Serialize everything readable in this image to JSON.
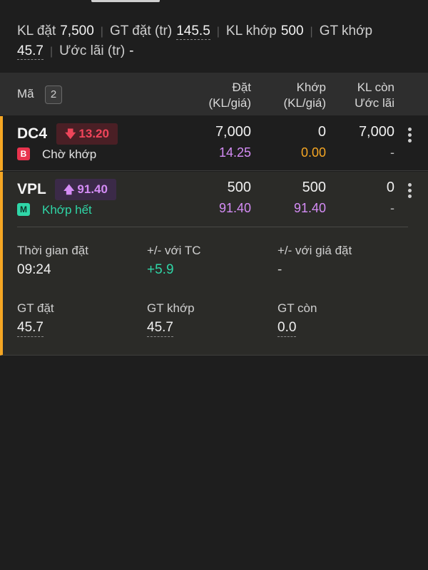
{
  "summary": {
    "kl_dat_label": "KL đặt",
    "kl_dat_value": "7,500",
    "gt_dat_label": "GT đặt (tr)",
    "gt_dat_value": "145.5",
    "kl_khop_label": "KL khớp",
    "kl_khop_value": "500",
    "gt_khop_label": "GT khớp",
    "gt_khop_value": "45.7",
    "uoc_lai_label": "Ước lãi (tr)",
    "uoc_lai_value": "-"
  },
  "table_header": {
    "ma": "Mã",
    "count": "2",
    "dat_line1": "Đặt",
    "dat_line2": "(KL/giá)",
    "khop_line1": "Khớp",
    "khop_line2": "(KL/giá)",
    "klcon_line1": "KL còn",
    "klcon_line2": "Ước lãi"
  },
  "orders": [
    {
      "symbol": "DC4",
      "price": "13.20",
      "side": "B",
      "status": "Chờ khớp",
      "dat_kl": "7,000",
      "dat_gia": "14.25",
      "khop_kl": "0",
      "khop_gia": "0.00",
      "kl_con": "7,000",
      "uoc_lai": "-"
    },
    {
      "symbol": "VPL",
      "price": "91.40",
      "side": "M",
      "status": "Khớp hết",
      "dat_kl": "500",
      "dat_gia": "91.40",
      "khop_kl": "500",
      "khop_gia": "91.40",
      "kl_con": "0",
      "uoc_lai": "-",
      "details": {
        "thoi_gian_dat_label": "Thời gian đặt",
        "thoi_gian_dat_value": "09:24",
        "vs_tc_label": "+/- với TC",
        "vs_tc_value": "+5.9",
        "vs_gia_dat_label": "+/- với giá đặt",
        "vs_gia_dat_value": "-",
        "gt_dat_label": "GT đặt",
        "gt_dat_value": "45.7",
        "gt_khop_label": "GT khớp",
        "gt_khop_value": "45.7",
        "gt_con_label": "GT còn",
        "gt_con_value": "0.0"
      }
    }
  ],
  "colors": {
    "accent": "#f5a623",
    "down": "#f0455a",
    "up_purple": "#d48cf5",
    "match_green": "#2fd6a7"
  }
}
